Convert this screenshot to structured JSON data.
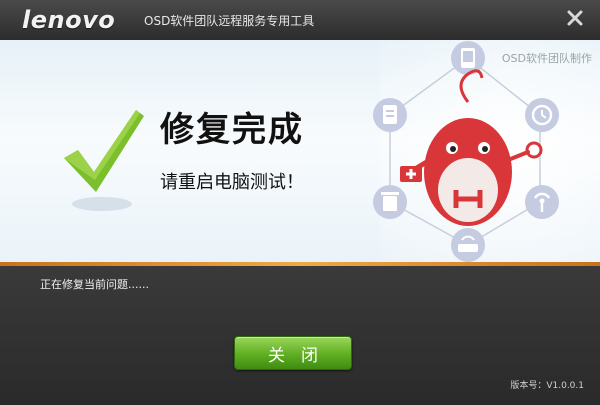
{
  "titlebar": {
    "logo_text": "lenovo",
    "title": "OSD软件团队远程服务专用工具",
    "close_icon": "close-icon"
  },
  "banner": {
    "made_by": "OSD软件团队制作",
    "headline": "修复完成",
    "subline": "请重启电脑测试！",
    "check_icon": "check-icon",
    "accent_color": "#7bbf2a",
    "icons": [
      "phone-icon",
      "clock-icon",
      "signal-icon",
      "router-icon",
      "trash-icon",
      "clipboard-icon",
      "first-aid-icon"
    ]
  },
  "main": {
    "status_text": "正在修复当前问题......",
    "close_button_label": "关闭",
    "version_text": "版本号：V1.0.0.1"
  },
  "colors": {
    "title_bar": "#2c2c2c",
    "divider": "#f0a845",
    "button_green": "#5fae22",
    "mascot_red": "#d9363a"
  }
}
